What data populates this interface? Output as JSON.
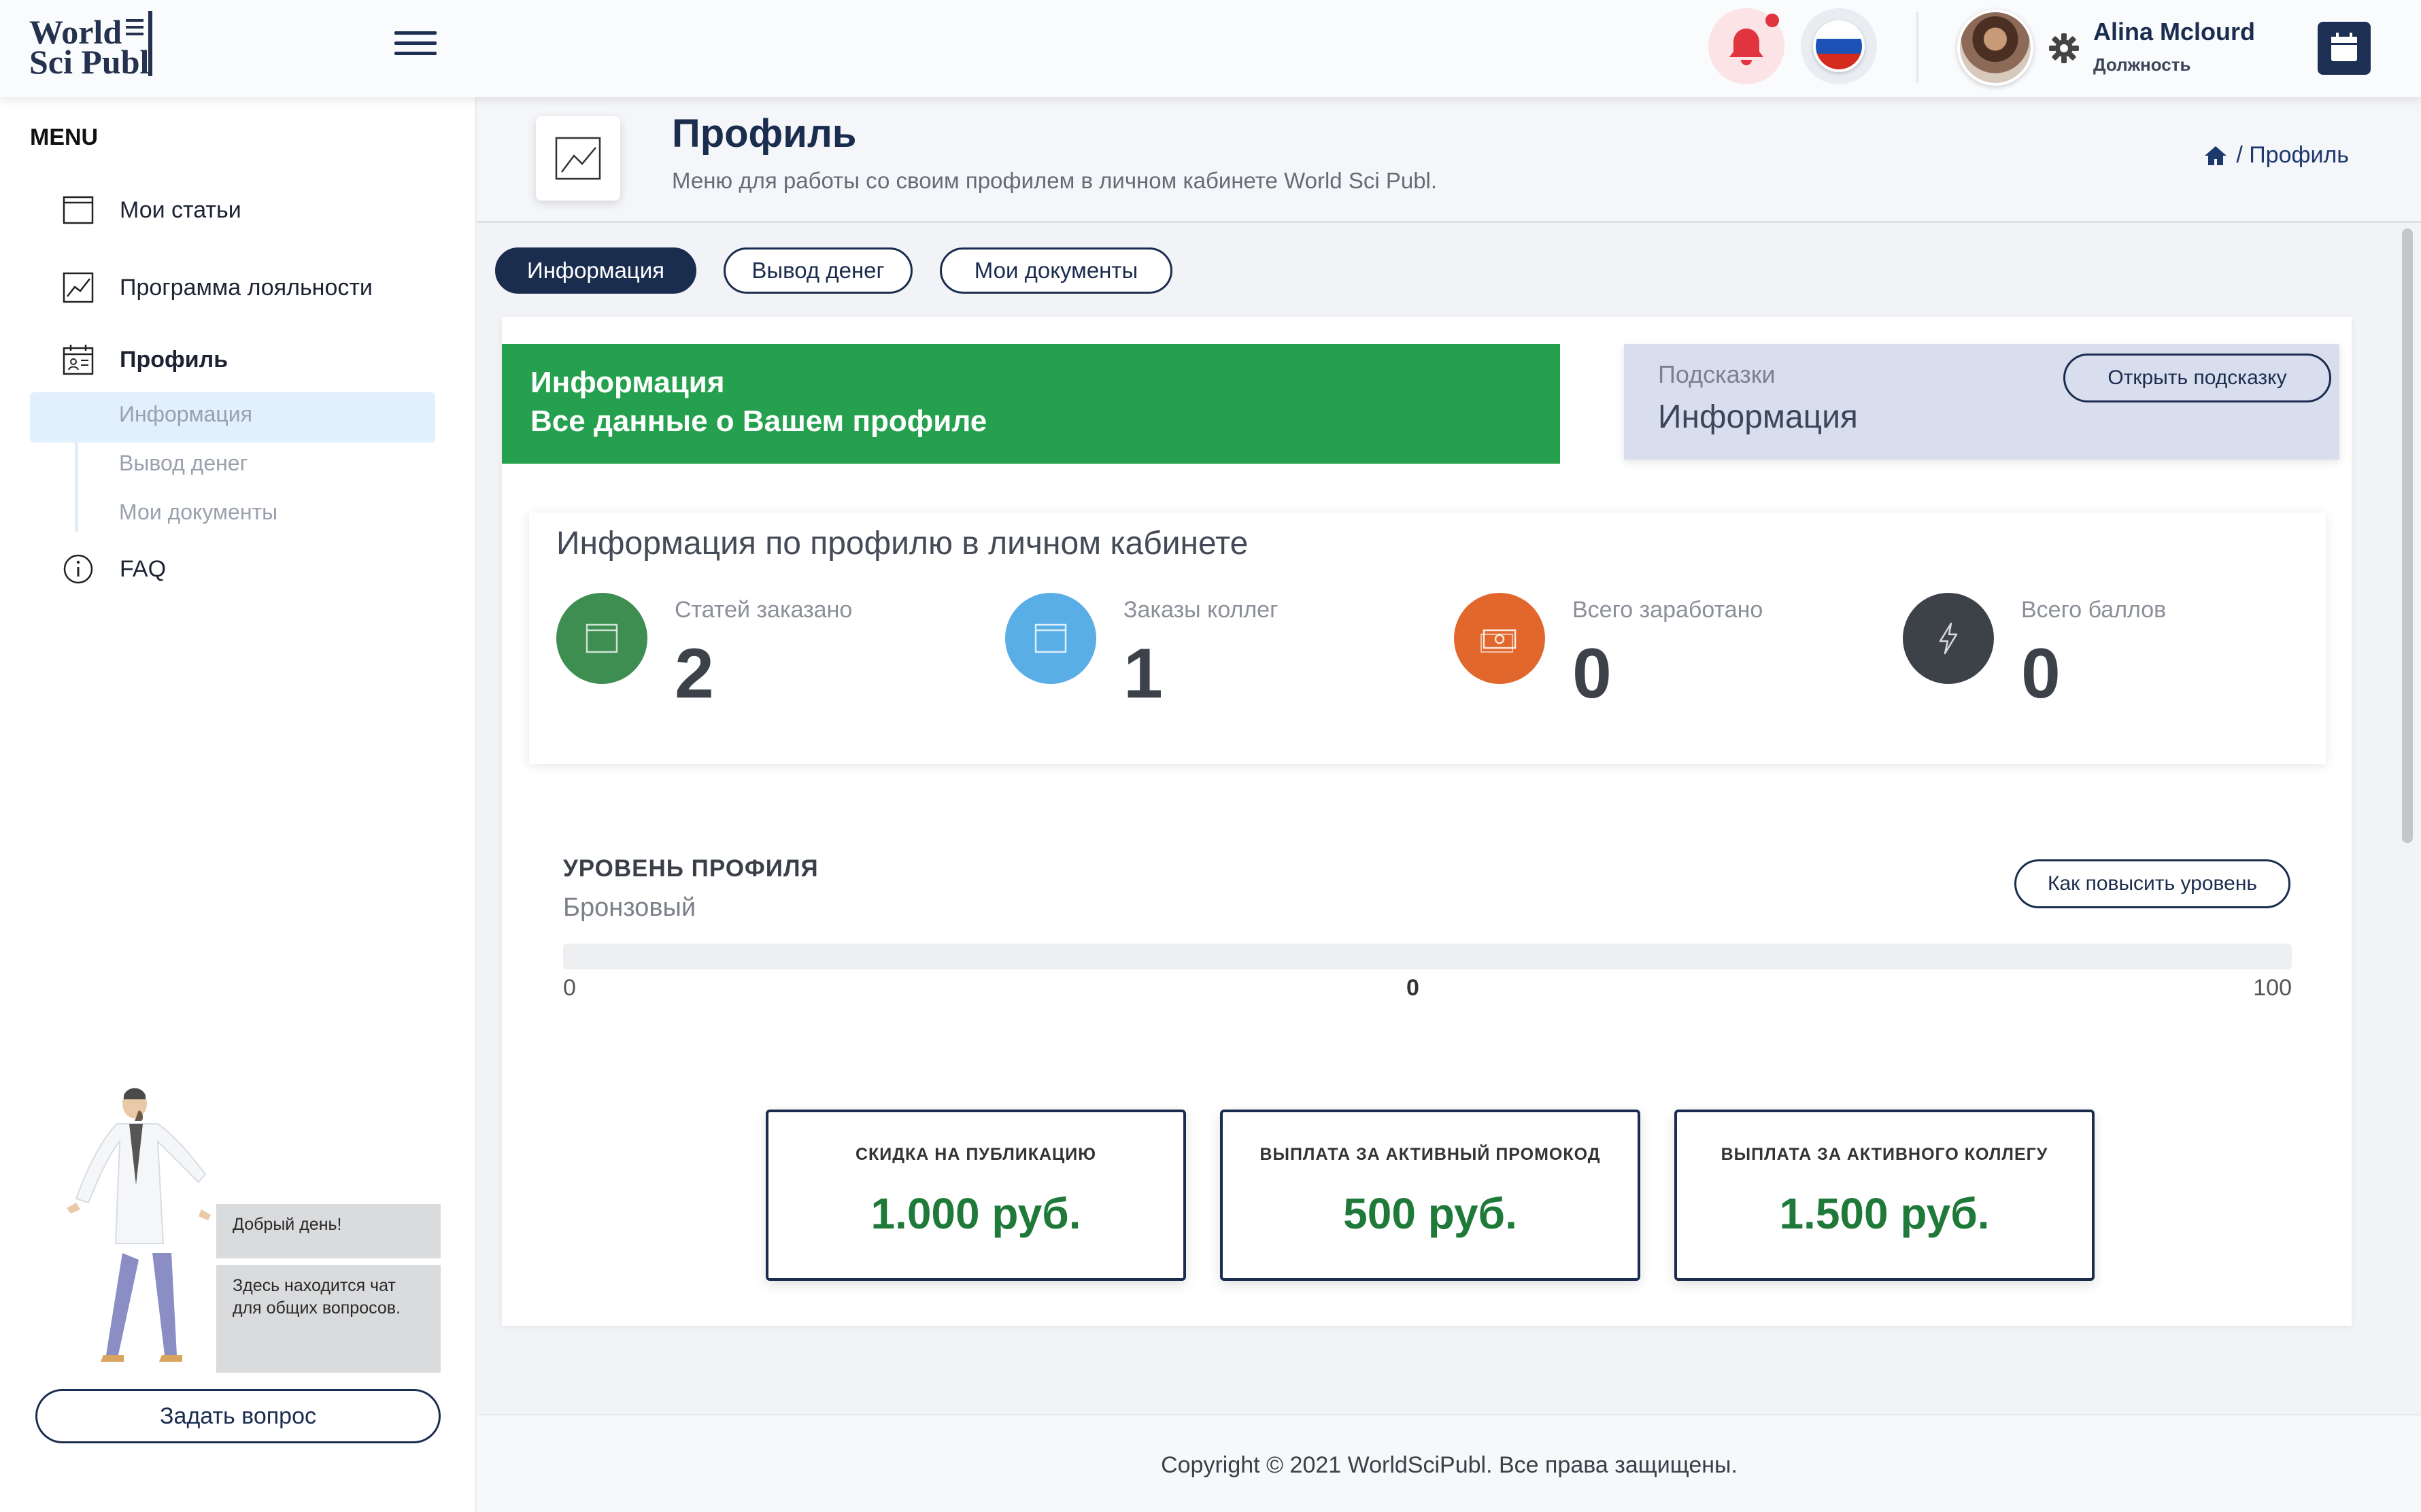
{
  "header": {
    "logo_line1": "World",
    "logo_line2": "Sci Publ",
    "user_name": "Alina Mclourd",
    "user_role": "Должность"
  },
  "sidebar": {
    "menu_title": "MENU",
    "items": [
      {
        "label": "Мои статьи",
        "icon": "browser-window-icon"
      },
      {
        "label": "Программа лояльности",
        "icon": "line-chart-icon"
      },
      {
        "label": "Профиль",
        "icon": "calendar-user-icon"
      },
      {
        "label": "FAQ",
        "icon": "info-circle-icon"
      }
    ],
    "sub_items": [
      "Информация",
      "Вывод денег",
      "Мои документы"
    ],
    "chat_bubble1": "Добрый день!",
    "chat_bubble2": "Здесь находится чат для общих вопросов.",
    "ask_button": "Задать вопрос"
  },
  "page": {
    "title": "Профиль",
    "subtitle": "Меню для работы со своим профилем в личном кабинете World Sci Publ.",
    "breadcrumb": "/ Профиль"
  },
  "tabs": [
    "Информация",
    "Вывод денег",
    "Мои документы"
  ],
  "banner": {
    "title": "Информация",
    "subtitle": "Все данные о Вашем профиле"
  },
  "hints": {
    "label": "Подсказки",
    "title": "Информация",
    "button": "Открыть подсказку"
  },
  "stats": {
    "title": "Информация по профилю в личном кабинете",
    "items": [
      {
        "label": "Статей заказано",
        "value": "2",
        "color": "#3e8e52",
        "icon": "browser-window-icon"
      },
      {
        "label": "Заказы коллег",
        "value": "1",
        "color": "#5aaee6",
        "icon": "browser-window-icon"
      },
      {
        "label": "Всего заработано",
        "value": "0",
        "color": "#e2672c",
        "icon": "money-icon"
      },
      {
        "label": "Всего баллов",
        "value": "0",
        "color": "#3d4248",
        "icon": "lightning-icon"
      }
    ]
  },
  "level": {
    "title": "УРОВЕНЬ ПРОФИЛЯ",
    "name": "Бронзовый",
    "button": "Как повысить уровень",
    "min": "0",
    "current": "0",
    "max": "100",
    "progress_fraction": 0
  },
  "rewards": [
    {
      "label": "СКИДКА НА ПУБЛИКАЦИЮ",
      "value": "1.000 руб."
    },
    {
      "label": "ВЫПЛАТА ЗА АКТИВНЫЙ ПРОМОКОД",
      "value": "500 руб."
    },
    {
      "label": "ВЫПЛАТА ЗА АКТИВНОГО КОЛЛЕГУ",
      "value": "1.500 руб."
    }
  ],
  "footer": {
    "copyright": "Copyright © 2021 WorldSciPubl. Все права защищены."
  },
  "colors": {
    "brand_navy": "#1b2d4f",
    "banner_green": "#25a04f",
    "reward_value_green": "#1f7a3a",
    "hint_bg": "#d9deee"
  }
}
